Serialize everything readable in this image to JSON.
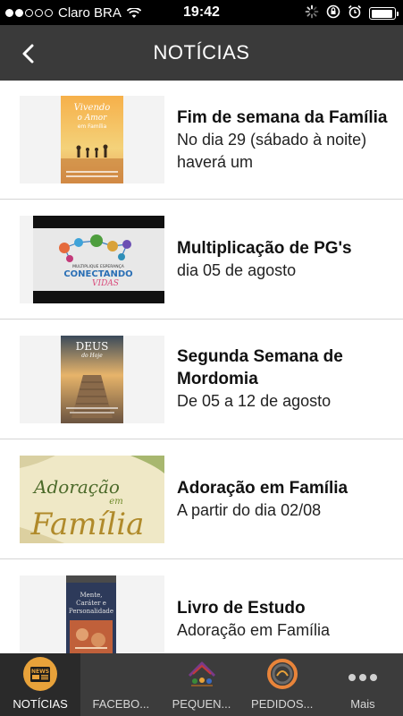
{
  "status_bar": {
    "carrier": "Claro BRA",
    "time": "19:42",
    "battery_level": 0.95
  },
  "header": {
    "title": "NOTÍCIAS",
    "back_icon": "chevron-left-icon"
  },
  "news": [
    {
      "title": "Fim de semana da Família",
      "description": "No dia 29 (sábado à noite) haverá um"
    },
    {
      "title": "Multiplicação de PG's",
      "description": "dia 05 de agosto"
    },
    {
      "title": "Segunda Semana de Mordomia",
      "description": "De 05 a 12 de agosto"
    },
    {
      "title": "Adoração em Família",
      "description": "A partir do dia 02/08"
    },
    {
      "title": "Livro de Estudo",
      "description": "Adoração em Família"
    }
  ],
  "tabs": [
    {
      "label": "NOTÍCIAS",
      "icon": "news-icon",
      "active": true
    },
    {
      "label": "FACEBO...",
      "icon": "facebook-icon",
      "active": false
    },
    {
      "label": "PEQUEN...",
      "icon": "small-groups-icon",
      "active": false
    },
    {
      "label": "PEDIDOS...",
      "icon": "requests-icon",
      "active": false
    },
    {
      "label": "Mais",
      "icon": "more-icon",
      "active": false
    }
  ],
  "colors": {
    "header_bg": "#3a3a3a",
    "tabbar_bg": "#3c3c3c",
    "active_tab_icon": "#e8a23a"
  }
}
